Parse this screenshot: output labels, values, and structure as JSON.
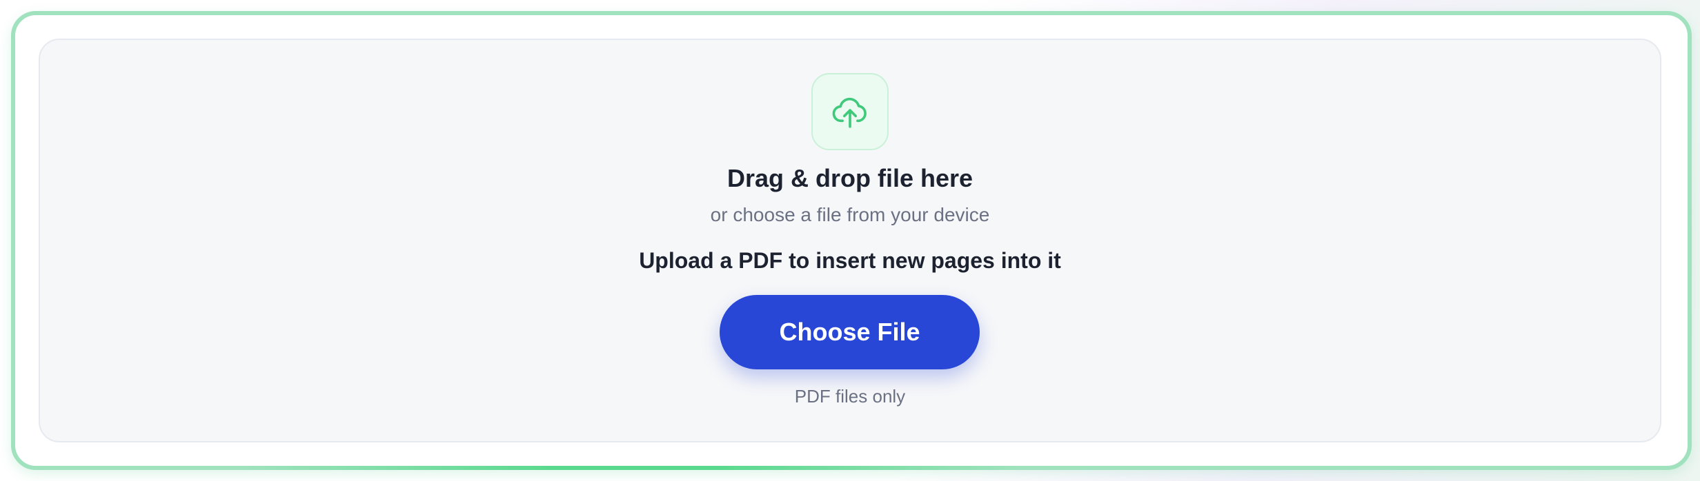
{
  "upload": {
    "icon": "cloud-upload-icon",
    "accent_color": "#3fc97a",
    "headline": "Drag & drop file here",
    "subline": "or choose a file from your device",
    "instruction": "Upload a PDF to insert new pages into it",
    "button_label": "Choose File",
    "button_color": "#2847d6",
    "hint": "PDF files only"
  }
}
